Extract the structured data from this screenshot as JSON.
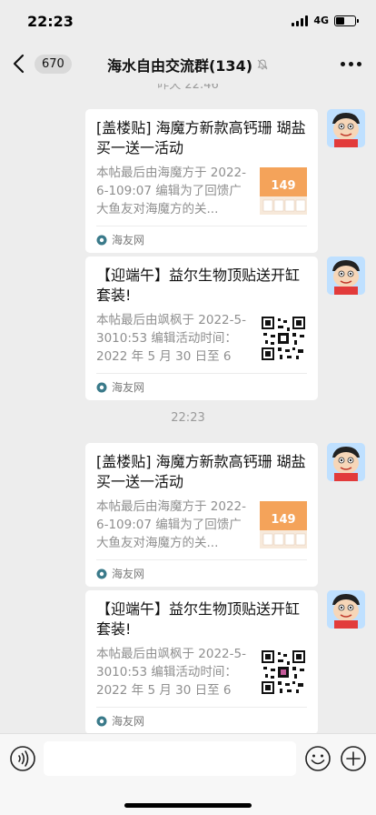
{
  "status_bar": {
    "time": "22:23",
    "network": "4G",
    "battery_level": 0.45
  },
  "nav": {
    "unread_count": "670",
    "title": "海水自由交流群(134)",
    "back_icon": "chevron-left-icon",
    "mute_icon": "mute-bell-icon",
    "more_icon": "more-dots-icon"
  },
  "chat": {
    "timestamps": [
      "昨天 22:46",
      "22:23"
    ],
    "messages": [
      {
        "title": "[盖楼贴] 海魔方新款高钙珊 瑚盐买一送一活动",
        "desc": "本帖最后由海魔方于 2022-6-109:07 编辑为了回馈广大鱼友对海魔方的关...",
        "source": "海友网",
        "thumb": "product-promo",
        "thumb_price": "149"
      },
      {
        "title": "【迎端午】益尔生物顶贴送开缸套装!",
        "desc": "本帖最后由飒枫于 2022-5-3010:53 编辑活动时间：2022 年 5 月 30 日至 6 月...",
        "source": "海友网",
        "thumb": "qr-code"
      },
      {
        "title": "[盖楼贴] 海魔方新款高钙珊 瑚盐买一送一活动",
        "desc": "本帖最后由海魔方于 2022-6-109:07 编辑为了回馈广大鱼友对海魔方的关...",
        "source": "海友网",
        "thumb": "product-promo",
        "thumb_price": "149"
      },
      {
        "title": "【迎端午】益尔生物顶贴送开缸套装!",
        "desc": "本帖最后由飒枫于 2022-5-3010:53 编辑活动时间：2022 年 5 月 30 日至 6 月...",
        "source": "海友网",
        "thumb": "qr-code"
      }
    ]
  },
  "input_bar": {
    "placeholder": "",
    "voice_icon": "voice-icon",
    "emoji_icon": "emoji-icon",
    "plus_icon": "plus-icon"
  }
}
